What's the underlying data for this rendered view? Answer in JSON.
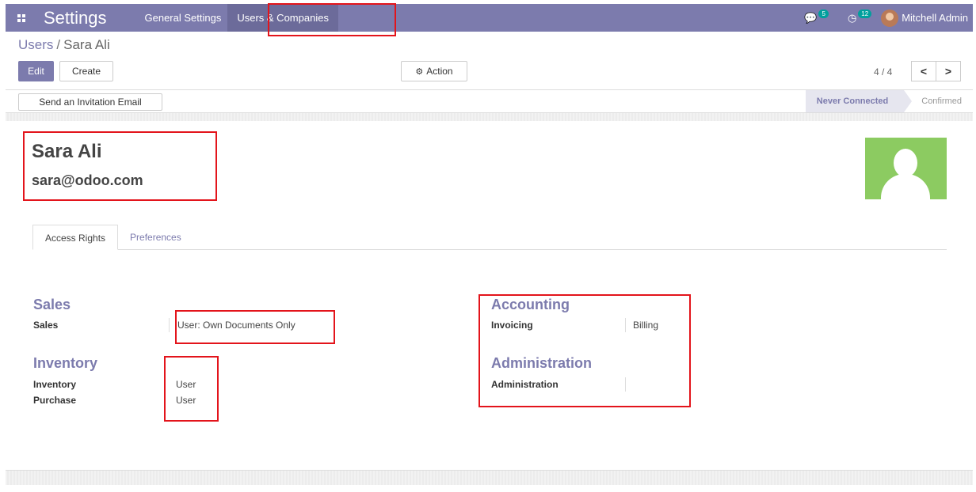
{
  "navbar": {
    "app_name": "Settings",
    "menus": [
      "General Settings",
      "Users & Companies"
    ],
    "messages_count": "5",
    "activities_count": "12",
    "user_name": "Mitchell Admin"
  },
  "breadcrumb": {
    "parent": "Users",
    "separator": "/",
    "current": "Sara Ali"
  },
  "toolbar": {
    "edit_label": "Edit",
    "create_label": "Create",
    "action_label": "Action",
    "pager": "4 / 4",
    "prev": "<",
    "next": ">"
  },
  "statusbar": {
    "invite_label": "Send an Invitation Email",
    "steps": [
      "Never Connected",
      "Confirmed"
    ]
  },
  "record": {
    "name": "Sara Ali",
    "email": "sara@odoo.com"
  },
  "tabs": [
    "Access Rights",
    "Preferences"
  ],
  "groups": {
    "sales": {
      "title": "Sales",
      "fields": [
        {
          "label": "Sales",
          "value": "User: Own Documents Only"
        }
      ]
    },
    "inventory": {
      "title": "Inventory",
      "fields": [
        {
          "label": "Inventory",
          "value": "User"
        },
        {
          "label": "Purchase",
          "value": "User"
        }
      ]
    },
    "accounting": {
      "title": "Accounting",
      "fields": [
        {
          "label": "Invoicing",
          "value": "Billing"
        }
      ]
    },
    "administration": {
      "title": "Administration",
      "fields": [
        {
          "label": "Administration",
          "value": ""
        }
      ]
    }
  },
  "colors": {
    "brand": "#7c7bad",
    "highlight": "#e3141b",
    "avatar_bg": "#8ccb61"
  }
}
